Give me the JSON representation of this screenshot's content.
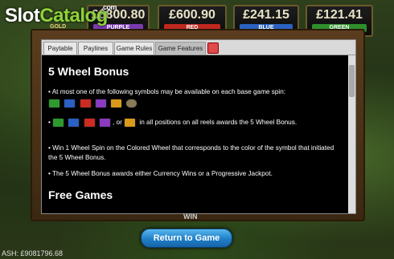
{
  "logo": {
    "slot": "Slot",
    "catalog": "Catalog",
    "dotcom": ".com"
  },
  "jackpots": [
    {
      "amount": "£8800.80",
      "label": "PURPLE",
      "color": "#7a3bb0"
    },
    {
      "amount": "£600.90",
      "label": "RED",
      "color": "#c0281f"
    },
    {
      "amount": "£241.15",
      "label": "BLUE",
      "color": "#2a62c0"
    },
    {
      "amount": "£121.41",
      "label": "GREEN",
      "color": "#2e8f2a"
    }
  ],
  "gold_label": "GOLD",
  "tabs": [
    "Paytable",
    "Paylines",
    "Game Rules",
    "Game Features"
  ],
  "content": {
    "heading1": "5 Wheel Bonus",
    "bullet1": "• At most one of the following symbols may be available on each base game spin:",
    "bullet2_prefix": "•",
    "bullet2_mid": ", or",
    "bullet2_text": "in all positions on all reels awards the 5 Wheel Bonus.",
    "bullet3": "• Win 1 Wheel Spin on the Colored Wheel that corresponds to the color of the symbol that initiated the 5 Wheel Bonus.",
    "bullet4": "• The 5 Wheel Bonus awards either Currency Wins or a Progressive Jackpot.",
    "heading2": "Free Games"
  },
  "symbol_colors": [
    "#2e9a2e",
    "#2a5fc4",
    "#cc2b22",
    "#8a3bbf",
    "#d99a1a",
    "#8a7a55"
  ],
  "win_label": "WIN",
  "return_button": "Return to Game",
  "cash": "ASH: £9081796.68"
}
